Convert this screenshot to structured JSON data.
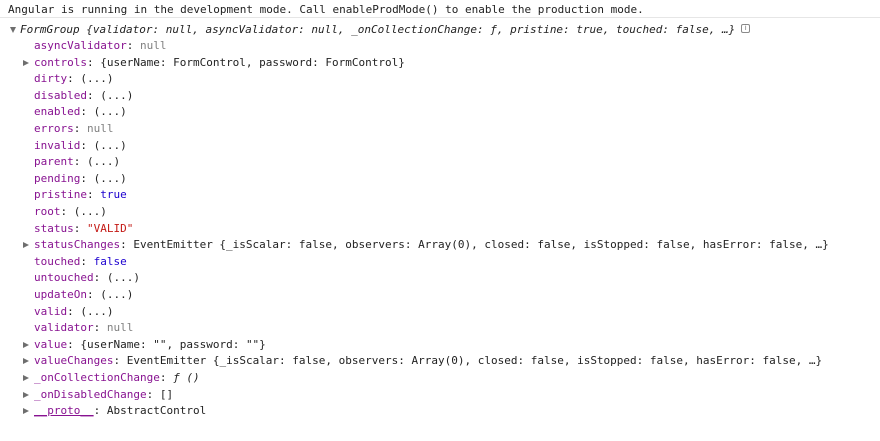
{
  "console": {
    "message": "Angular is running in the development mode. Call enableProdMode() to enable the production mode.",
    "object": {
      "class_name": "FormGroup",
      "preview": "{validator: null, asyncValidator: null, _onCollectionChange: ƒ, pristine: true, touched: false, …}",
      "info_glyph": "i",
      "properties": [
        {
          "key": "asyncValidator",
          "value": "null",
          "expandable": false,
          "kind": "nullish"
        },
        {
          "key": "controls",
          "value": "{userName: FormControl, password: FormControl}",
          "expandable": true,
          "kind": "obj"
        },
        {
          "key": "dirty",
          "value": "(...)",
          "expandable": false,
          "kind": "obj"
        },
        {
          "key": "disabled",
          "value": "(...)",
          "expandable": false,
          "kind": "obj"
        },
        {
          "key": "enabled",
          "value": "(...)",
          "expandable": false,
          "kind": "obj"
        },
        {
          "key": "errors",
          "value": "null",
          "expandable": false,
          "kind": "nullish"
        },
        {
          "key": "invalid",
          "value": "(...)",
          "expandable": false,
          "kind": "obj"
        },
        {
          "key": "parent",
          "value": "(...)",
          "expandable": false,
          "kind": "obj"
        },
        {
          "key": "pending",
          "value": "(...)",
          "expandable": false,
          "kind": "obj"
        },
        {
          "key": "pristine",
          "value": "true",
          "expandable": false,
          "kind": "num"
        },
        {
          "key": "root",
          "value": "(...)",
          "expandable": false,
          "kind": "obj"
        },
        {
          "key": "status",
          "value": "\"VALID\"",
          "expandable": false,
          "kind": "str"
        },
        {
          "key": "statusChanges",
          "value": "EventEmitter {_isScalar: false, observers: Array(0), closed: false, isStopped: false, hasError: false, …}",
          "expandable": true,
          "kind": "obj"
        },
        {
          "key": "touched",
          "value": "false",
          "expandable": false,
          "kind": "num"
        },
        {
          "key": "untouched",
          "value": "(...)",
          "expandable": false,
          "kind": "obj"
        },
        {
          "key": "updateOn",
          "value": "(...)",
          "expandable": false,
          "kind": "obj"
        },
        {
          "key": "valid",
          "value": "(...)",
          "expandable": false,
          "kind": "obj"
        },
        {
          "key": "validator",
          "value": "null",
          "expandable": false,
          "kind": "nullish"
        },
        {
          "key": "value",
          "value": "{userName: \"\", password: \"\"}",
          "expandable": true,
          "kind": "obj"
        },
        {
          "key": "valueChanges",
          "value": "EventEmitter {_isScalar: false, observers: Array(0), closed: false, isStopped: false, hasError: false, …}",
          "expandable": true,
          "kind": "obj"
        },
        {
          "key": "_onCollectionChange",
          "value": "ƒ ()",
          "expandable": true,
          "kind": "fn"
        },
        {
          "key": "_onDisabledChange",
          "value": "[]",
          "expandable": true,
          "kind": "obj"
        },
        {
          "key": "__proto__",
          "value": "AbstractControl",
          "expandable": true,
          "kind": "obj"
        }
      ]
    }
  },
  "colors": {
    "key": "#881391",
    "string": "#c41a16",
    "keyword": "#1c00cf",
    "null": "#808080"
  }
}
